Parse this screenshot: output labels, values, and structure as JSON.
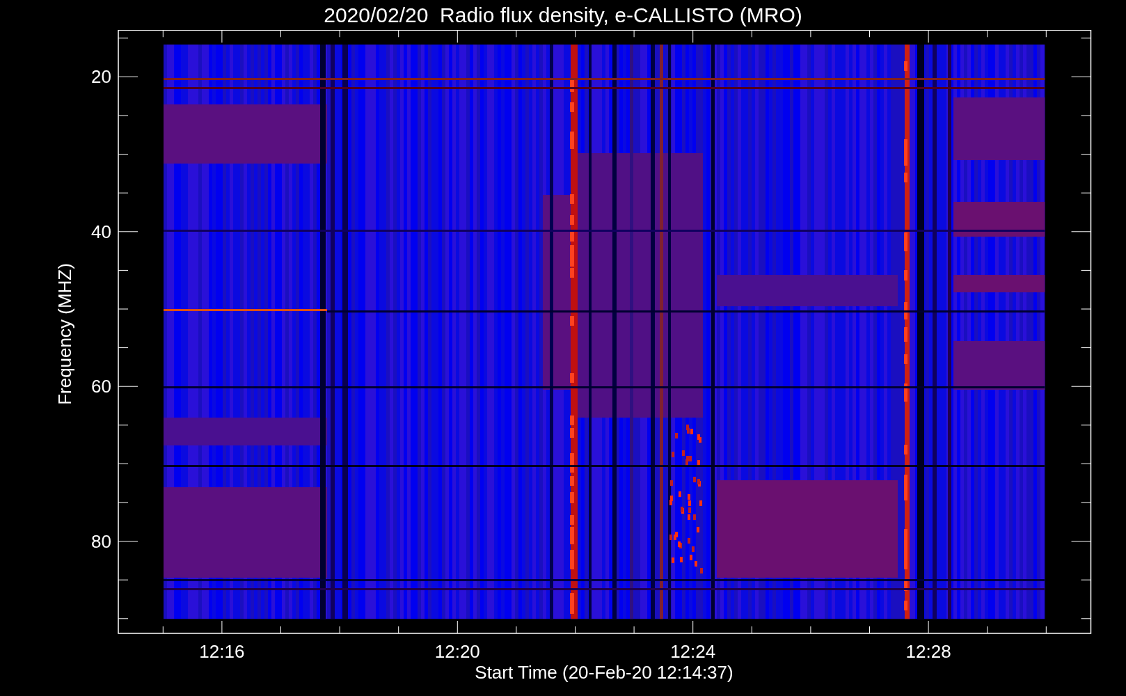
{
  "title": "2020/02/20  Radio flux density, e-CALLISTO (MRO)",
  "plot": {
    "xlabel": "Start Time (20-Feb-20 12:14:37)",
    "ylabel": "Frequency (MHZ)",
    "xticks": [
      "12:16",
      "12:20",
      "12:24",
      "12:28"
    ],
    "yticks": [
      "20",
      "40",
      "60",
      "80"
    ]
  }
}
